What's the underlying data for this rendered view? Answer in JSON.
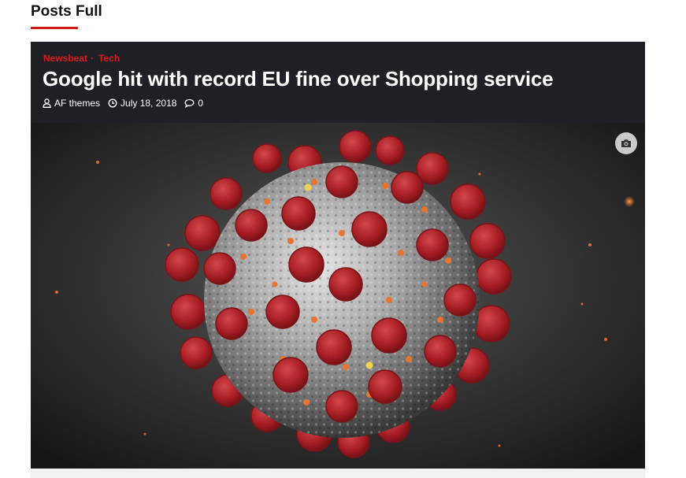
{
  "section": {
    "title": "Posts Full",
    "accent_color": "#d01818"
  },
  "post": {
    "categories": [
      "Newsbeat",
      "Tech"
    ],
    "category_separator": "·",
    "title": "Google hit with record EU fine over Shopping service",
    "author": "AF themes",
    "date": "July 18, 2018",
    "comments": "0",
    "image_icon": "camera-icon",
    "category_color": "#d81d1d"
  },
  "icons": {
    "author": "user-icon",
    "date": "clock-icon",
    "comments": "comment-icon"
  }
}
